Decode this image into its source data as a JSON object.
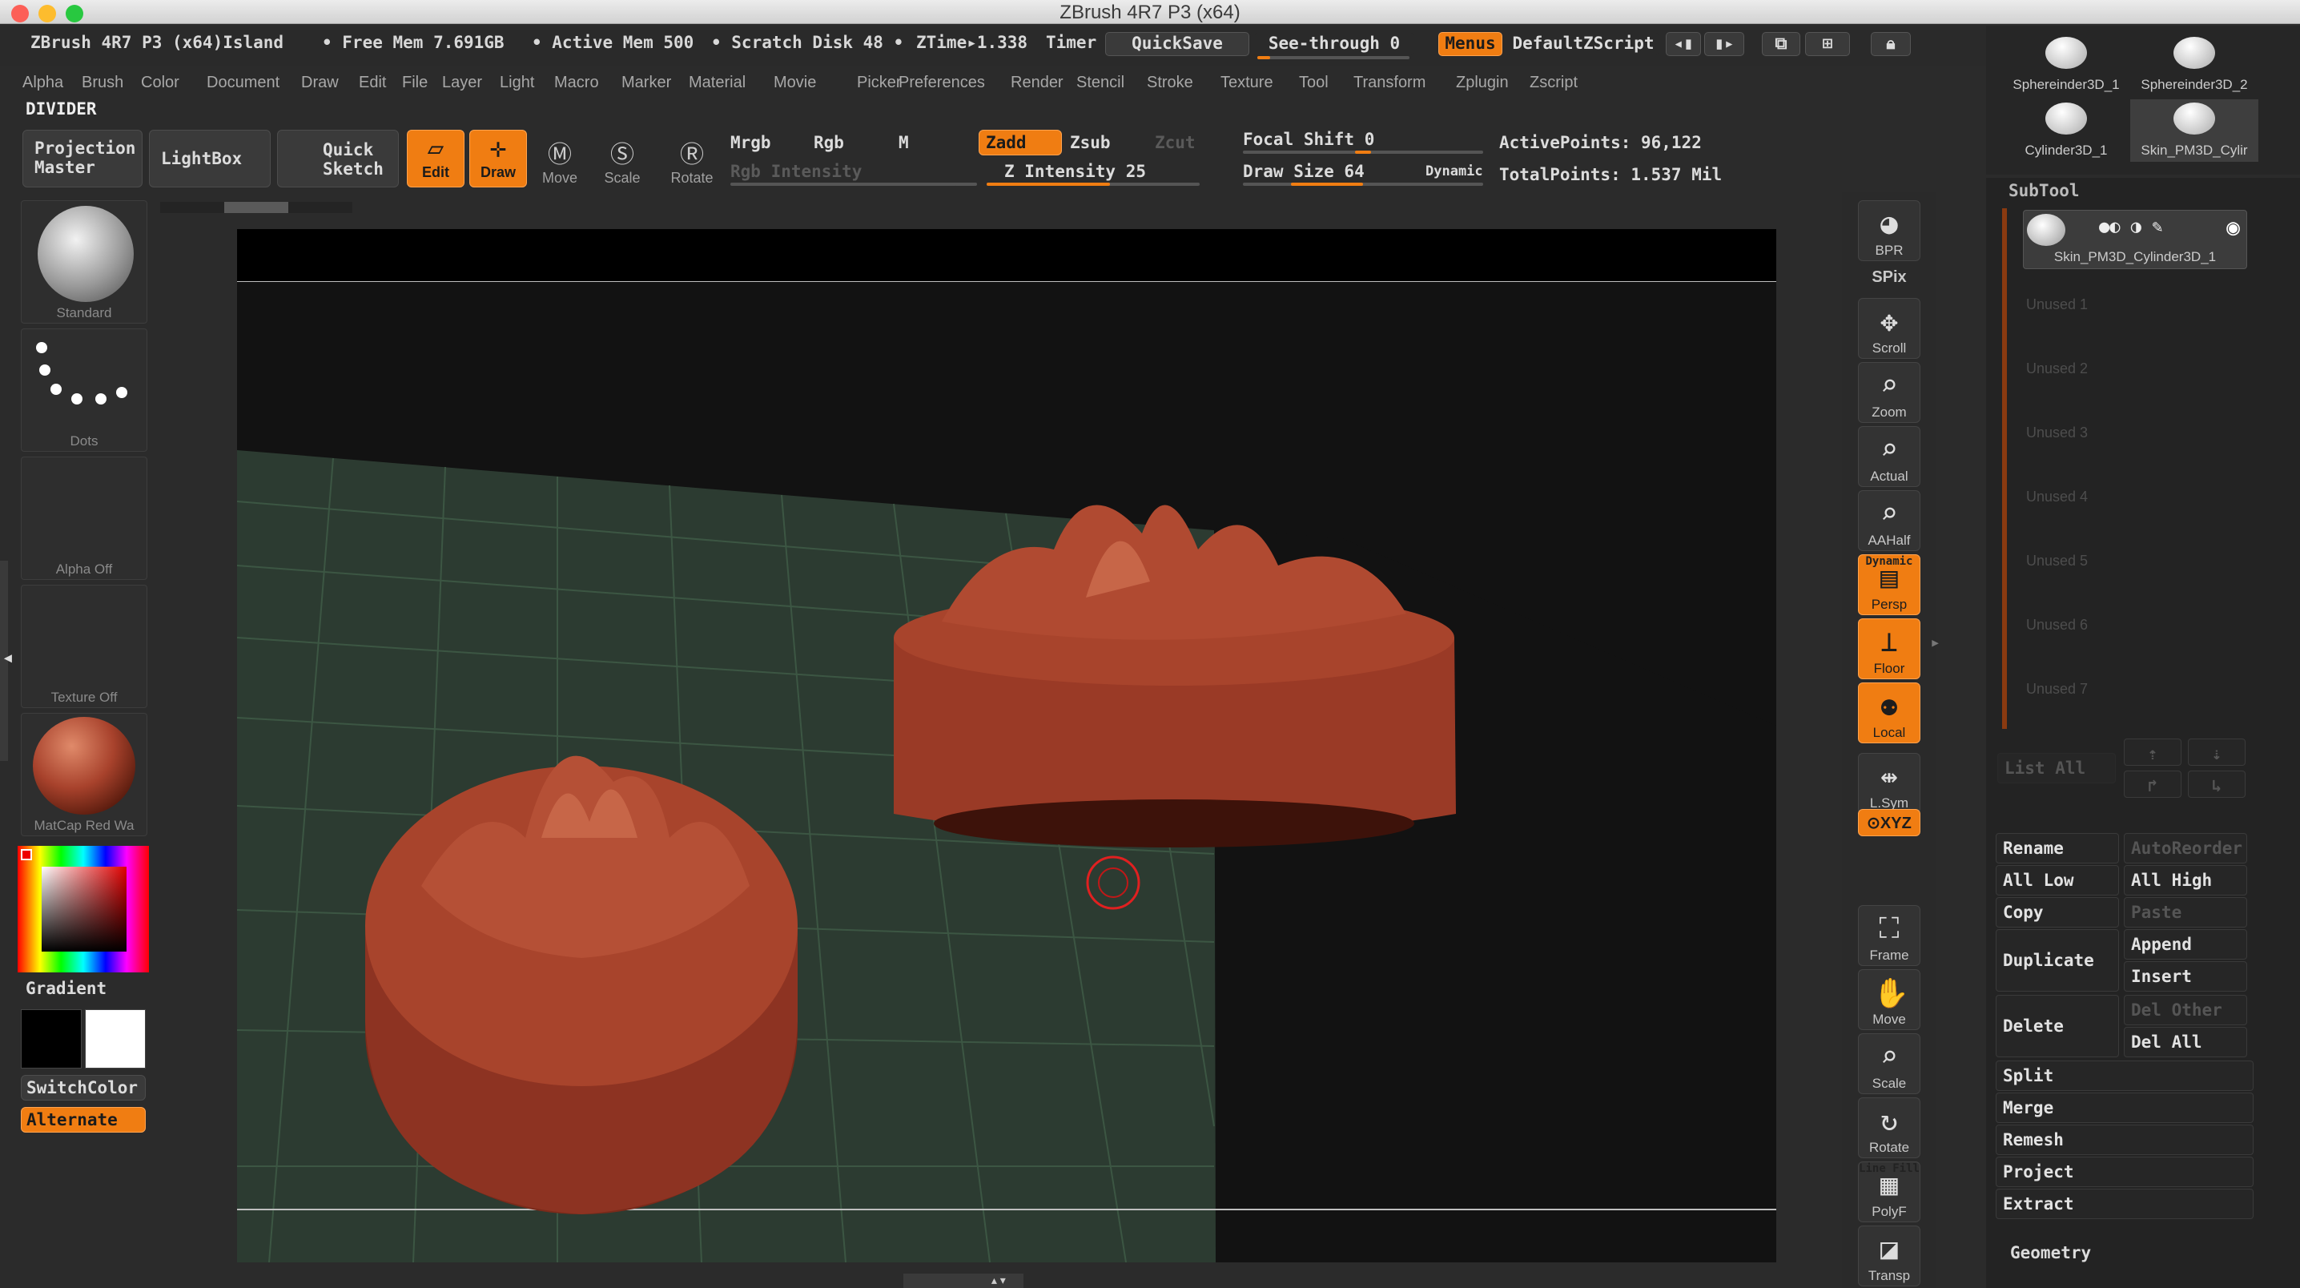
{
  "window": {
    "title": "ZBrush 4R7 P3 (x64)"
  },
  "info": {
    "app": "ZBrush 4R7 P3 (x64)Island",
    "free_mem": "• Free Mem 7.691GB",
    "active_mem": "• Active Mem 500",
    "scratch": "• Scratch Disk 48 •",
    "ztime": "ZTime▸1.338",
    "timer": "Timer",
    "quicksave": "QuickSave",
    "seethrough": "See-through  0",
    "menus": "Menus",
    "script": "DefaultZScript"
  },
  "menus": [
    "Alpha",
    "Brush",
    "Color",
    "Document",
    "Draw",
    "Edit",
    "File",
    "Layer",
    "Light",
    "Macro",
    "Marker",
    "Material",
    "Movie",
    "Picker",
    "Preferences",
    "Render",
    "Stencil",
    "Stroke",
    "Texture",
    "Tool",
    "Transform",
    "Zplugin",
    "Zscript"
  ],
  "divider": "DIVIDER",
  "toolbar": {
    "projection": "Projection Master",
    "lightbox": "LightBox",
    "quicksketch": "Quick Sketch",
    "edit": "Edit",
    "draw": "Draw",
    "move": "Move",
    "scale": "Scale",
    "rotate": "Rotate",
    "mrgb": "Mrgb",
    "rgb": "Rgb",
    "m": "M",
    "rgb_intensity": "Rgb Intensity",
    "zadd": "Zadd",
    "zsub": "Zsub",
    "zcut": "Zcut",
    "z_intensity": "Z Intensity 25",
    "focal_shift": "Focal Shift 0",
    "draw_size": "Draw Size 64",
    "dynamic": "Dynamic",
    "active_points": "ActivePoints: 96,122",
    "total_points": "TotalPoints: 1.537 Mil"
  },
  "left": {
    "brush": "Standard",
    "stroke": "Dots",
    "alpha": "Alpha  Off",
    "texture": "Texture  Off",
    "material": "MatCap  Red  Wa",
    "gradient": "Gradient",
    "switchcolor": "SwitchColor",
    "alternate": "Alternate"
  },
  "right_shelf": [
    {
      "id": "bpr",
      "label": "BPR"
    },
    {
      "id": "spix",
      "label": "SPix"
    },
    {
      "id": "scroll",
      "label": "Scroll"
    },
    {
      "id": "zoom",
      "label": "Zoom"
    },
    {
      "id": "actual",
      "label": "Actual"
    },
    {
      "id": "aahalf",
      "label": "AAHalf"
    },
    {
      "id": "persp",
      "label": "Persp",
      "top": "Dynamic"
    },
    {
      "id": "floor",
      "label": "Floor"
    },
    {
      "id": "local",
      "label": "Local"
    },
    {
      "id": "lsym",
      "label": "L.Sym"
    },
    {
      "id": "xyz",
      "label": "⊙XYZ"
    },
    {
      "id": "frame",
      "label": "Frame"
    },
    {
      "id": "move",
      "label": "Move"
    },
    {
      "id": "scale",
      "label": "Scale"
    },
    {
      "id": "rotate",
      "label": "Rotate"
    },
    {
      "id": "polyf",
      "label": "PolyF",
      "top": "Line Fill"
    },
    {
      "id": "transp",
      "label": "Transp"
    }
  ],
  "tools": [
    "Sphereinder3D_1",
    "Sphereinder3D_2",
    "Cylinder3D_1",
    "Skin_PM3D_Cylir"
  ],
  "subtool": {
    "title": "SubTool",
    "active": "Skin_PM3D_Cylinder3D_1",
    "unused": [
      "Unused  1",
      "Unused  2",
      "Unused  3",
      "Unused  4",
      "Unused  5",
      "Unused  6",
      "Unused  7"
    ],
    "list_all": "List  All",
    "rename": "Rename",
    "autoreorder": "AutoReorder",
    "all_low": "All Low",
    "all_high": "All High",
    "copy": "Copy",
    "paste": "Paste",
    "duplicate": "Duplicate",
    "append": "Append",
    "insert": "Insert",
    "delete": "Delete",
    "del_other": "Del Other",
    "del_all": "Del All",
    "split": "Split",
    "merge": "Merge",
    "remesh": "Remesh",
    "project": "Project",
    "extract": "Extract",
    "geometry": "Geometry"
  },
  "colors": {
    "accent": "#f07d12",
    "model": "#a8422c",
    "floor_grid": "#3e5a46"
  }
}
